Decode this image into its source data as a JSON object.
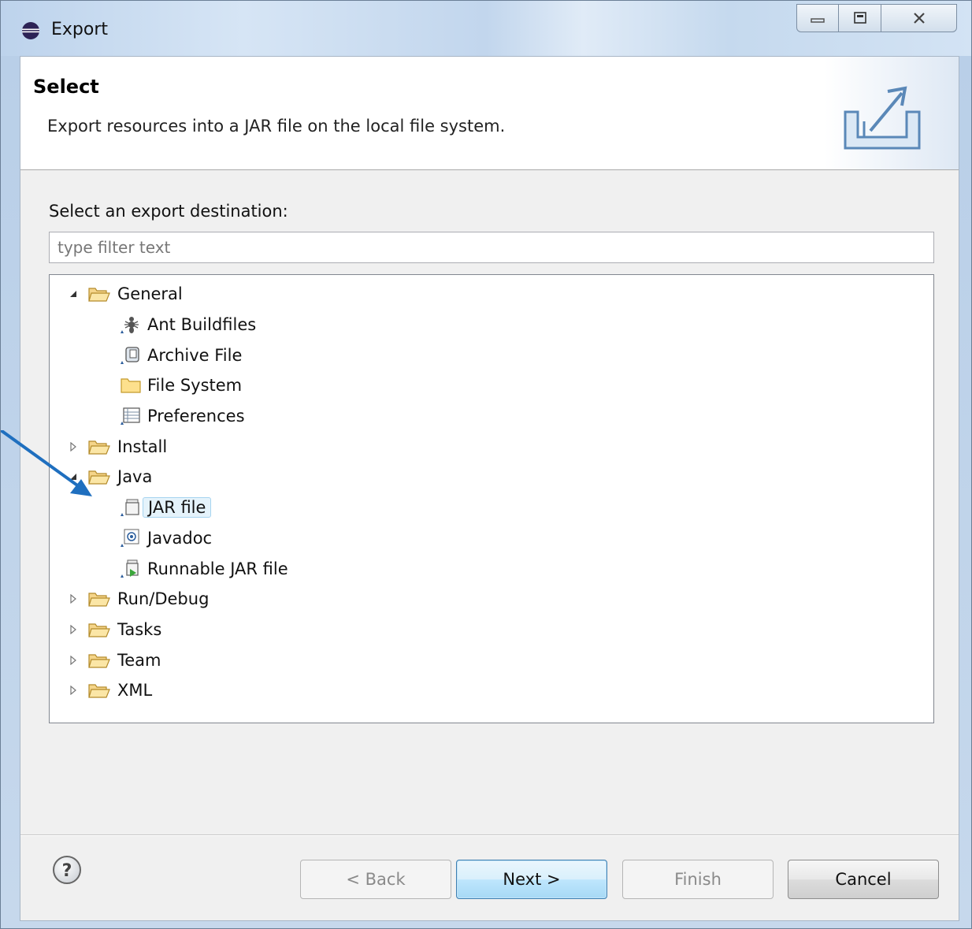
{
  "window": {
    "title": "Export",
    "controls": {
      "minimize": "minimize",
      "maximize": "maximize",
      "close": "close"
    }
  },
  "banner": {
    "title": "Select",
    "description": "Export resources into a JAR file on the local file system."
  },
  "main": {
    "prompt": "Select an export destination:",
    "filter": {
      "placeholder": "type filter text",
      "value": ""
    }
  },
  "tree": [
    {
      "label": "General",
      "expanded": true,
      "icon": "open-folder-icon",
      "children": [
        {
          "label": "Ant Buildfiles",
          "icon": "ant-icon"
        },
        {
          "label": "Archive File",
          "icon": "archive-icon"
        },
        {
          "label": "File System",
          "icon": "folder-icon"
        },
        {
          "label": "Preferences",
          "icon": "preferences-icon"
        }
      ]
    },
    {
      "label": "Install",
      "expanded": false,
      "icon": "open-folder-icon"
    },
    {
      "label": "Java",
      "expanded": true,
      "icon": "open-folder-icon",
      "children": [
        {
          "label": "JAR file",
          "icon": "jar-icon",
          "selected": true
        },
        {
          "label": "Javadoc",
          "icon": "javadoc-icon"
        },
        {
          "label": "Runnable JAR file",
          "icon": "runnable-jar-icon"
        }
      ]
    },
    {
      "label": "Run/Debug",
      "expanded": false,
      "icon": "open-folder-icon"
    },
    {
      "label": "Tasks",
      "expanded": false,
      "icon": "open-folder-icon"
    },
    {
      "label": "Team",
      "expanded": false,
      "icon": "open-folder-icon"
    },
    {
      "label": "XML",
      "expanded": false,
      "icon": "open-folder-icon"
    }
  ],
  "buttons": {
    "back": "< Back",
    "next": "Next >",
    "finish": "Finish",
    "cancel": "Cancel"
  },
  "colors": {
    "annotation_arrow": "#1f6fbf",
    "selection_bg": "#e5f3fb",
    "default_button": "#a7d9f5"
  }
}
